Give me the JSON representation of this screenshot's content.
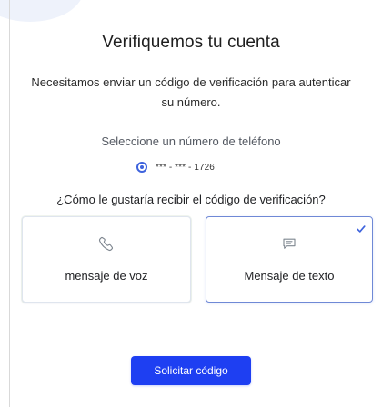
{
  "screen": {
    "title": "Verifiquemos tu cuenta",
    "description": "Necesitamos enviar un código de verificación para autenticar su número.",
    "select_label": "Seleccione un número de teléfono",
    "phone_option": {
      "number": "*** - *** - 1726",
      "selected": true
    },
    "question": "¿Cómo le gustaría recibir el código de verificación?",
    "methods": [
      {
        "label": "mensaje de voz",
        "icon": "phone-icon",
        "selected": false
      },
      {
        "label": "Mensaje de texto",
        "icon": "message-icon",
        "selected": true
      }
    ],
    "request_button_label": "Solicitar código"
  },
  "colors": {
    "accent": "#1e3ff2",
    "selected_border": "#6f89d6",
    "background": "#ffffff"
  }
}
